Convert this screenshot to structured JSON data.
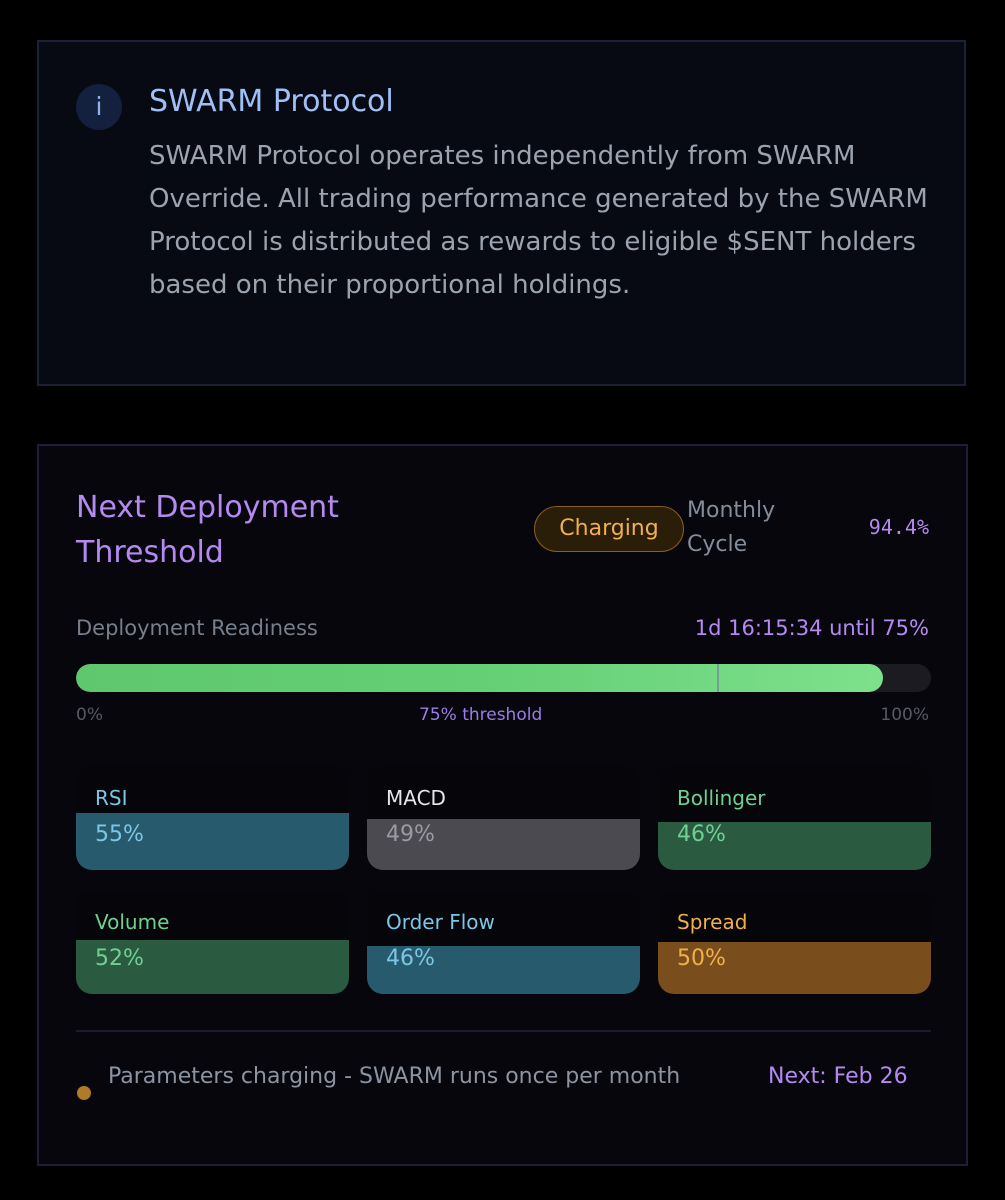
{
  "info": {
    "icon": "info-icon",
    "icon_glyph": "i",
    "title": "SWARM Protocol",
    "body": "SWARM Protocol operates independently from SWARM Override. All trading performance generated by the SWARM Protocol is distributed as rewards to eligible $SENT holders based on their proportional holdings."
  },
  "deployment": {
    "title": "Next Deployment Threshold",
    "status": "Charging",
    "cycle_label": "Monthly Cycle",
    "cycle_value": "94.4%",
    "readiness_label": "Deployment Readiness",
    "readiness_eta": "1d 16:15:34 until 75%",
    "progress_percent": 94.4,
    "threshold_percent": 75,
    "scale_min": "0%",
    "scale_mid": "75% threshold",
    "scale_max": "100%"
  },
  "indicators": [
    {
      "name": "RSI",
      "value": "55%",
      "percent": 55,
      "name_color": "#7cc6e6",
      "value_color": "#7cc6e6",
      "fill_color": "#265a6c"
    },
    {
      "name": "MACD",
      "value": "49%",
      "percent": 49,
      "name_color": "#e6e6e6",
      "value_color": "#9a9aa2",
      "fill_color": "#4a4a50"
    },
    {
      "name": "Bollinger",
      "value": "46%",
      "percent": 46,
      "name_color": "#6fd092",
      "value_color": "#6fd092",
      "fill_color": "#2a5a40"
    },
    {
      "name": "Volume",
      "value": "52%",
      "percent": 52,
      "name_color": "#6fd092",
      "value_color": "#6fd092",
      "fill_color": "#2a5a40"
    },
    {
      "name": "Order Flow",
      "value": "46%",
      "percent": 46,
      "name_color": "#7cc6e6",
      "value_color": "#7cc6e6",
      "fill_color": "#265a6c"
    },
    {
      "name": "Spread",
      "value": "50%",
      "percent": 50,
      "name_color": "#f0b04a",
      "value_color": "#f0b04a",
      "fill_color": "#7a4e1c"
    }
  ],
  "footer": {
    "status_text": "Parameters charging - SWARM runs once per month",
    "next_text": "Next: Feb 26"
  }
}
